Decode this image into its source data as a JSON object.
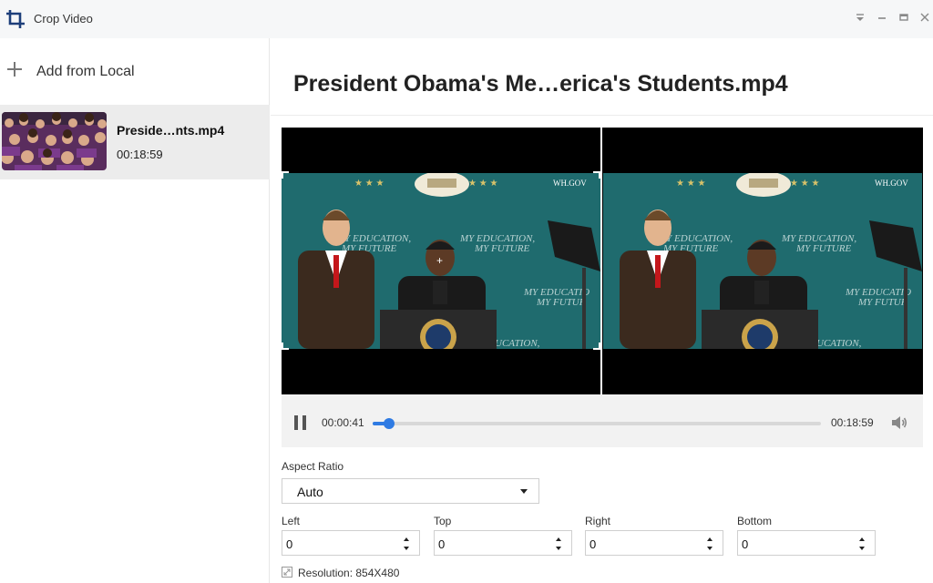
{
  "window": {
    "title": "Crop Video"
  },
  "sidebar": {
    "add_label": "Add from Local",
    "files": [
      {
        "name": "Preside…nts.mp4",
        "duration": "00:18:59"
      }
    ]
  },
  "main": {
    "title": "President Obama's Me…erica's Students.mp4",
    "preview": {
      "left_overlay": "WH.GOV",
      "right_overlay": "WH.GOV"
    },
    "player": {
      "current_time": "00:00:41",
      "total_time": "00:18:59",
      "progress": 0.036
    },
    "aspect_ratio": {
      "label": "Aspect Ratio",
      "value": "Auto"
    },
    "crop": {
      "left": {
        "label": "Left",
        "value": "0"
      },
      "top": {
        "label": "Top",
        "value": "0"
      },
      "right": {
        "label": "Right",
        "value": "0"
      },
      "bottom": {
        "label": "Bottom",
        "value": "0"
      }
    },
    "resolution": "Resolution: 854X480"
  },
  "colors": {
    "accent": "#2f7be3",
    "backdrop": "#1f6b6e"
  }
}
